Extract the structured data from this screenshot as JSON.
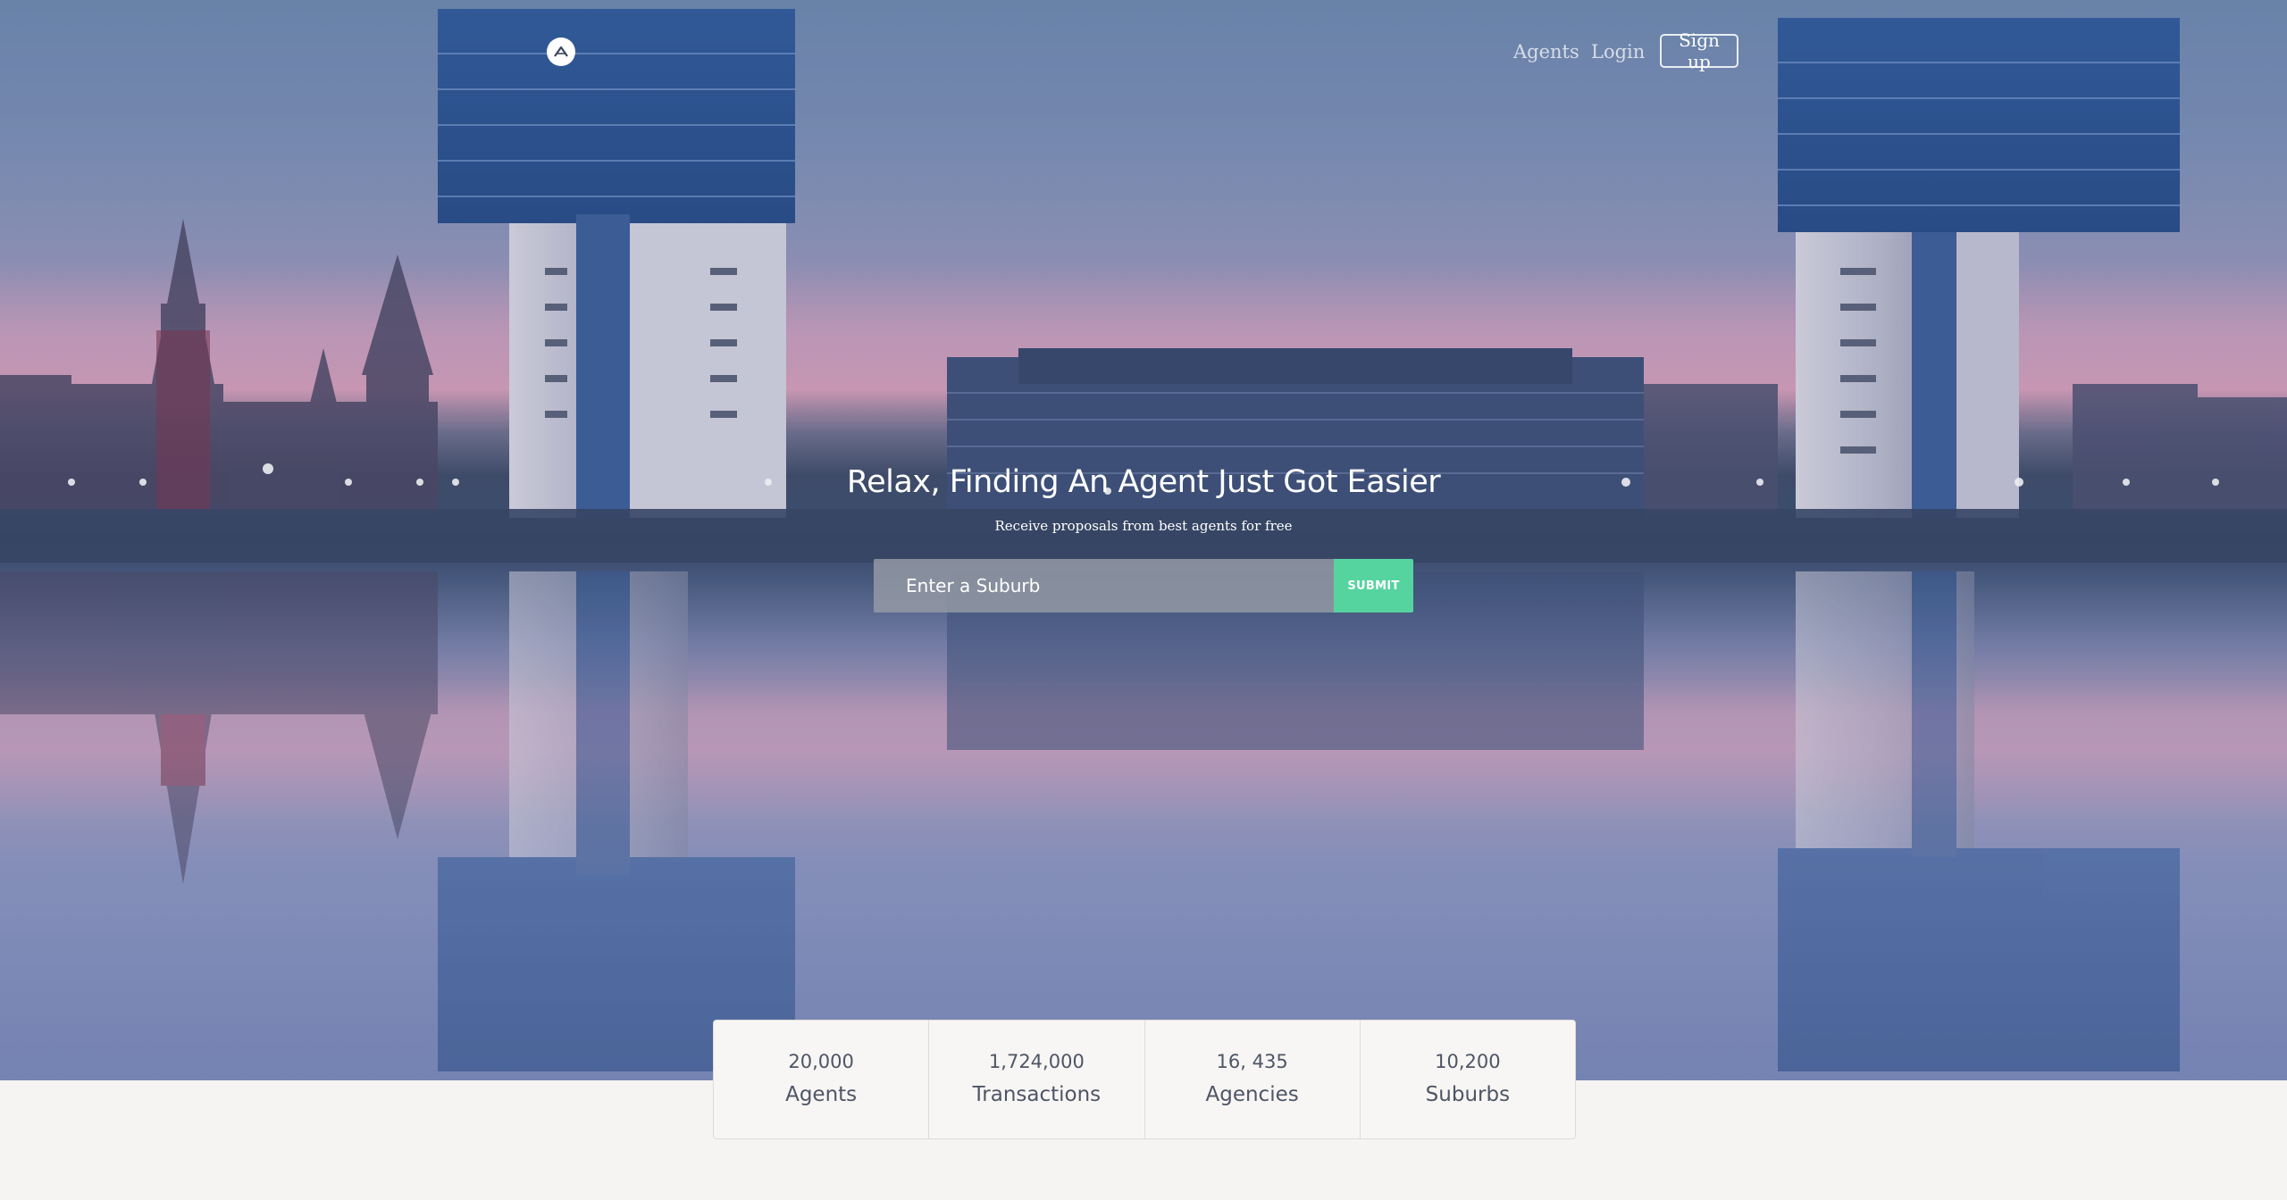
{
  "nav": {
    "logo_icon": "chevron-up-logo",
    "agents_label": "Agents",
    "login_label": "Login",
    "signup_label": "Sign up"
  },
  "hero": {
    "headline": "Relax, Finding An Agent Just Got Easier",
    "subline": "Receive proposals from best agents for free"
  },
  "search": {
    "placeholder": "Enter a Suburb",
    "value": "",
    "submit_label": "SUBMIT",
    "submit_color": "#56d4a0"
  },
  "stats": [
    {
      "value": "20,000",
      "label": "Agents"
    },
    {
      "value": "1,724,000",
      "label": "Transactions"
    },
    {
      "value": "16, 435",
      "label": "Agencies"
    },
    {
      "value": "10,200",
      "label": "Suburbs"
    }
  ]
}
